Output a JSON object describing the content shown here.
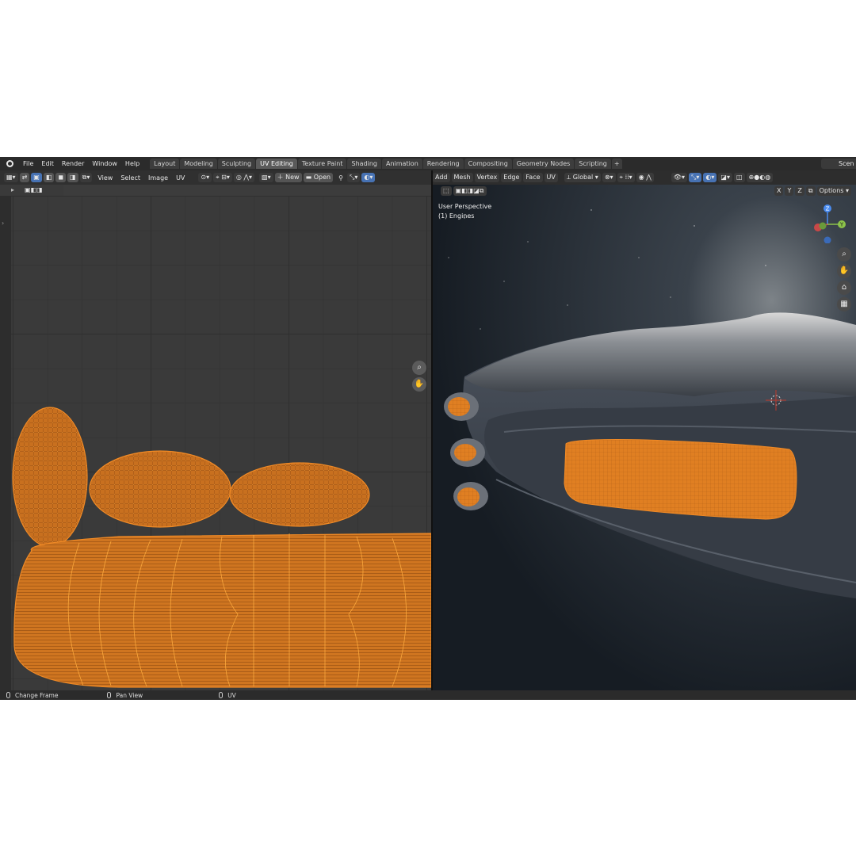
{
  "menu": [
    "File",
    "Edit",
    "Render",
    "Window",
    "Help"
  ],
  "workspaces": [
    "Layout",
    "Modeling",
    "Sculpting",
    "UV Editing",
    "Texture Paint",
    "Shading",
    "Animation",
    "Rendering",
    "Compositing",
    "Geometry Nodes",
    "Scripting",
    "+"
  ],
  "active_workspace": "UV Editing",
  "scene_label": "Scen",
  "uv_editor": {
    "menus": [
      "View",
      "Select",
      "Image",
      "UV"
    ],
    "new_label": "New",
    "open_label": "Open"
  },
  "viewport": {
    "menus": [
      "Add",
      "Mesh",
      "Vertex",
      "Edge",
      "Face",
      "UV"
    ],
    "transform_orientation": "Global",
    "axes": [
      "X",
      "Y",
      "Z"
    ],
    "options_label": "Options",
    "perspective_label": "User Perspective",
    "object_label": "(1) Engines",
    "gizmo_axes": [
      "Z",
      "Y"
    ]
  },
  "status": {
    "items": [
      "Change Frame",
      "Pan View",
      "UV"
    ]
  },
  "colors": {
    "accent_orange": "#e8801e",
    "selection_blue": "#4772b3"
  }
}
